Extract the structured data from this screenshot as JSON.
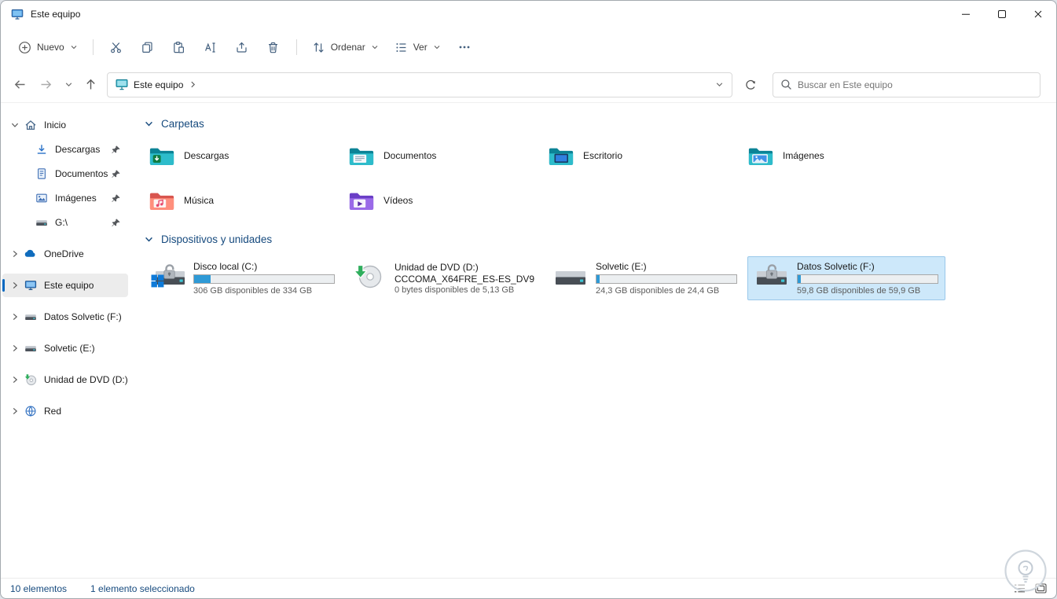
{
  "window": {
    "title": "Este equipo"
  },
  "toolbar": {
    "new_label": "Nuevo",
    "sort_label": "Ordenar",
    "view_label": "Ver",
    "icons": [
      "new-icon",
      "cut-icon",
      "copy-icon",
      "paste-icon",
      "rename-icon",
      "share-icon",
      "delete-icon",
      "sort-icon",
      "view-icon",
      "more-icon"
    ]
  },
  "navbar": {
    "breadcrumb_root": "Este equipo",
    "search_placeholder": "Buscar en Este equipo",
    "icons": [
      "back-icon",
      "forward-icon",
      "history-chevron-icon",
      "up-icon",
      "this-pc-icon",
      "refresh-icon",
      "search-icon"
    ]
  },
  "sidebar": {
    "items": [
      {
        "label": "Inicio",
        "icon": "home-icon",
        "state": "expanded"
      },
      {
        "label": "Descargas",
        "icon": "downloads-icon",
        "pinned": true
      },
      {
        "label": "Documentos",
        "icon": "document-icon",
        "pinned": true
      },
      {
        "label": "Imágenes",
        "icon": "pictures-icon",
        "pinned": true
      },
      {
        "label": "G:\\",
        "icon": "drive-icon",
        "pinned": true
      },
      {
        "label": "OneDrive",
        "icon": "onedrive-icon",
        "state": "collapsed"
      },
      {
        "label": "Este equipo",
        "icon": "computer-icon",
        "state": "collapsed",
        "selected": true
      },
      {
        "label": "Datos Solvetic (F:)",
        "icon": "drive-icon",
        "state": "collapsed"
      },
      {
        "label": "Solvetic (E:)",
        "icon": "drive-icon",
        "state": "collapsed"
      },
      {
        "label": "Unidad de DVD (D:)",
        "icon": "dvd-icon",
        "state": "collapsed"
      },
      {
        "label": "Red",
        "icon": "network-icon",
        "state": "collapsed"
      }
    ]
  },
  "content": {
    "folders": {
      "title": "Carpetas",
      "items": [
        {
          "name": "Descargas",
          "icon": "downloads-folder-icon"
        },
        {
          "name": "Documentos",
          "icon": "documents-folder-icon"
        },
        {
          "name": "Escritorio",
          "icon": "desktop-folder-icon"
        },
        {
          "name": "Imágenes",
          "icon": "pictures-folder-icon"
        },
        {
          "name": "Música",
          "icon": "music-folder-icon"
        },
        {
          "name": "Vídeos",
          "icon": "videos-folder-icon"
        }
      ]
    },
    "devices": {
      "title": "Dispositivos y unidades",
      "items": [
        {
          "name": "Disco local (C:)",
          "free_text": "306 GB disponibles de 334 GB",
          "bar_fill": "12%",
          "icon": "local-disk-bitlocker-icon"
        },
        {
          "name": "Unidad de DVD (D:)",
          "volume_label": "CCCOMA_X64FRE_ES-ES_DV9",
          "free_text": "0 bytes disponibles de 5,13 GB",
          "icon": "dvd-drive-icon"
        },
        {
          "name": "Solvetic (E:)",
          "free_text": "24,3 GB disponibles de 24,4 GB",
          "bar_fill": "2%",
          "icon": "hard-drive-icon"
        },
        {
          "name": "Datos Solvetic (F:)",
          "free_text": "59,8 GB disponibles de 59,9 GB",
          "bar_fill": "2%",
          "icon": "hard-drive-bitlocker-icon",
          "selected": true
        }
      ]
    }
  },
  "statusbar": {
    "total": "10 elementos",
    "selected": "1 elemento seleccionado"
  },
  "colors": {
    "accent": "#0067c0",
    "selection_bg": "#cde8fa",
    "selection_border": "#9ac8ea",
    "progress_fill": "#2f9ad6",
    "section_header_text": "#164a7e"
  }
}
